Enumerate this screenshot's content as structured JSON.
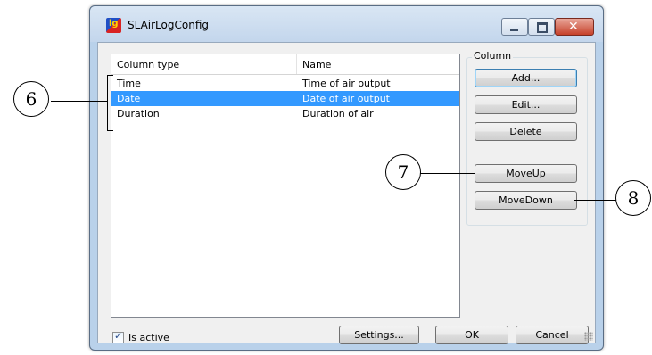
{
  "window": {
    "title": "SLAirLogConfig",
    "app_icon_text": "lg"
  },
  "listview": {
    "columns": [
      "Column type",
      "Name"
    ],
    "rows": [
      {
        "type": "Time",
        "name": "Time of air output",
        "selected": false
      },
      {
        "type": "Date",
        "name": "Date of air output",
        "selected": true
      },
      {
        "type": "Duration",
        "name": "Duration of air",
        "selected": false
      }
    ]
  },
  "column_group": {
    "label": "Column",
    "add": "Add...",
    "edit": "Edit...",
    "delete": "Delete",
    "move_up": "MoveUp",
    "move_down": "MoveDown"
  },
  "footer": {
    "is_active_label": "Is active",
    "is_active_checked": true,
    "settings": "Settings...",
    "ok": "OK",
    "cancel": "Cancel"
  },
  "callouts": {
    "six": "6",
    "seven": "7",
    "eight": "8"
  },
  "colors": {
    "selection": "#3399ff",
    "title_bar": "#c3d6ec",
    "dialog_bg": "#f0f0f0"
  }
}
